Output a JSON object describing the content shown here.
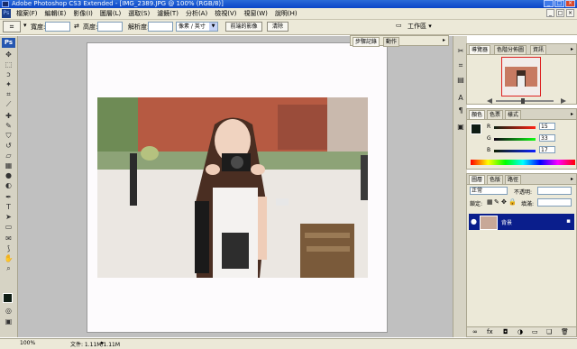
{
  "window": {
    "title": "Adobe Photoshop CS3 Extended - [IMG_2389.JPG @ 100% (RGB/8)]",
    "min": "_",
    "max": "□",
    "close": "×"
  },
  "menu": [
    "檔案(F)",
    "編輯(E)",
    "影像(I)",
    "圖層(L)",
    "選取(S)",
    "濾鏡(T)",
    "分析(A)",
    "檢視(V)",
    "視窗(W)",
    "說明(H)"
  ],
  "options": {
    "tool_glyph": "⌗",
    "width_label": "寬度:",
    "height_label": "高度:",
    "resolution_label": "解析度:",
    "unit": "像素 / 英寸",
    "front_image_button": "前端的影像",
    "clear_button": "清除",
    "workspace": "工作區 ▾"
  },
  "history_panel": {
    "tab1": "步驟記錄",
    "tab2": "動作"
  },
  "navigator_panel": {
    "tab1": "導覽器",
    "tab2": "色階分佈圖",
    "tab3": "資訊"
  },
  "color_panel": {
    "tab1": "顏色",
    "tab2": "色票",
    "tab3": "樣式",
    "r_label": "R",
    "g_label": "G",
    "b_label": "B",
    "r": "15",
    "g": "33",
    "b": "17",
    "r_color": "#ce1f1f",
    "g_color": "#1f9a1f",
    "b_color": "#1f1fce"
  },
  "layers_panel": {
    "tab1": "圖層",
    "tab2": "色版",
    "tab3": "路徑",
    "blend_mode": "正常",
    "opacity_label": "不透明:",
    "lock_label": "鎖定:",
    "fill_label": "填滿:",
    "layer_name": "背景"
  },
  "status": {
    "zoom": "100%",
    "doc_info": "文件: 1.11M/1.11M"
  },
  "colors": {
    "foreground": "#0f1d14",
    "layer_selected": "#0a1e8c"
  }
}
